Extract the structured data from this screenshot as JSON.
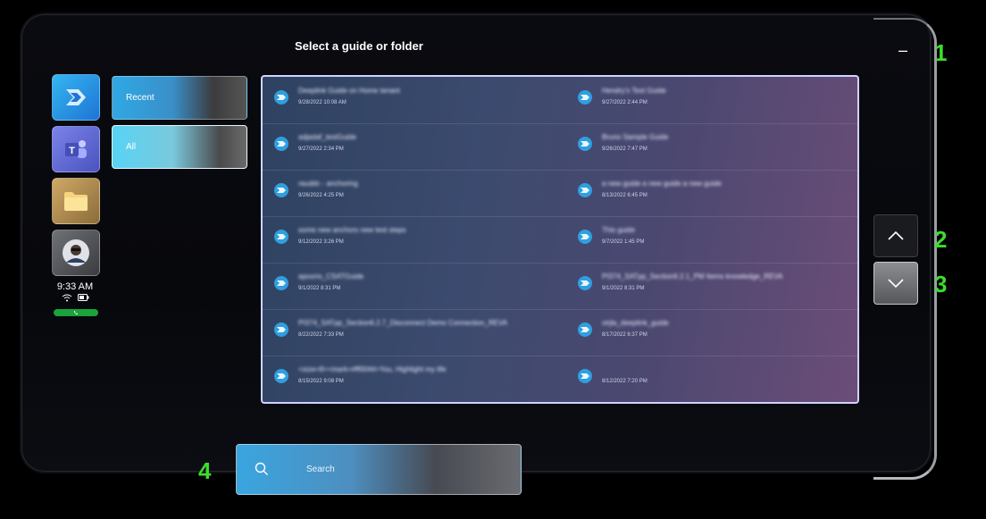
{
  "window": {
    "title": "Select a guide or folder",
    "minimize_label": "–"
  },
  "annotations": [
    "1",
    "2",
    "3",
    "4"
  ],
  "rail": {
    "apps": [
      {
        "name": "guides-app-icon",
        "color": "#34b6f0"
      },
      {
        "name": "teams-app-icon",
        "color": "#5b5fc7"
      },
      {
        "name": "folder-app-icon",
        "color": "#f5d57a"
      },
      {
        "name": "avatar-icon",
        "color": "#6e7176"
      }
    ],
    "time": "9:33 AM",
    "status_icons": [
      "wifi-icon",
      "battery-icon"
    ],
    "call_icon": "phone-icon"
  },
  "filters": {
    "recent_label": "Recent",
    "all_label": "All",
    "selected": "All"
  },
  "guides": [
    {
      "name": "Deeplink Guide on Home tenant",
      "date": "9/28/2022 10:08 AM"
    },
    {
      "name": "Hendry's Test Guide",
      "date": "9/27/2022 2:44 PM"
    },
    {
      "name": "adjadaf_testGuide",
      "date": "9/27/2022 2:34 PM"
    },
    {
      "name": "Bruno Sample Guide",
      "date": "9/26/2022 7:47 PM"
    },
    {
      "name": "rauddc - anchoring",
      "date": "9/26/2022 4:25 PM"
    },
    {
      "name": "a new guide a new guide a new guide",
      "date": "8/13/2022 6:45 PM"
    },
    {
      "name": "some new anchors new test steps",
      "date": "9/12/2022 3:26 PM"
    },
    {
      "name": "This guide",
      "date": "9/7/2022 1:45 PM"
    },
    {
      "name": "apoorio_CSATGuide",
      "date": "9/1/2022 8:31 PM"
    },
    {
      "name": "PI374_SATpp_Section6.2.1_PM Items knowledge_REVA",
      "date": "9/1/2022 8:31 PM"
    },
    {
      "name": "PI374_SATpp_Section6.2.7_Disconnect Demo Connection_REVA",
      "date": "8/22/2022 7:33 PM"
    },
    {
      "name": "virjla_deeplink_guide",
      "date": "8/17/2022 6:37 PM"
    },
    {
      "name": "<size=8><mark=#ff0044>You, Highlight my life",
      "date": "8/15/2022 9:08 PM"
    },
    {
      "name": "",
      "date": "8/12/2022 7:20 PM"
    }
  ],
  "scroll": {
    "up_icon": "chevron-up-icon",
    "down_icon": "chevron-down-icon"
  },
  "search": {
    "placeholder": "Search",
    "icon": "search-icon"
  },
  "colors": {
    "accent": "#34b6f0",
    "annotation": "#3ddc2e",
    "panel_border": "#cfd3ff"
  }
}
